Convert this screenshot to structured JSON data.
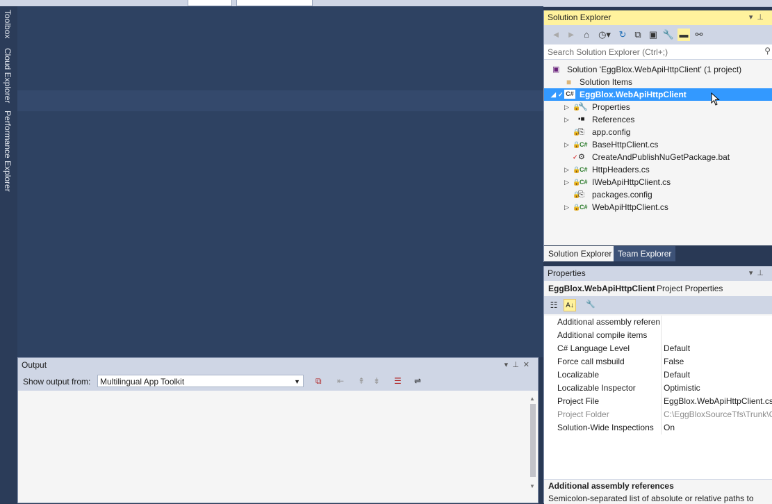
{
  "left_tabs": [
    "Toolbox",
    "Cloud Explorer",
    "Performance Explorer"
  ],
  "solution_explorer": {
    "title": "Solution Explorer",
    "search_placeholder": "Search Solution Explorer (Ctrl+;)",
    "toolbar_icons": [
      "back-icon",
      "forward-icon",
      "home-icon",
      "history-icon",
      "sync-icon",
      "collapse-all-icon",
      "show-all-files-icon",
      "properties-icon",
      "preview-icon",
      "class-diagram-icon"
    ],
    "tree": [
      {
        "label": "Solution 'EggBlox.WebApiHttpClient' (1 project)",
        "icon": "solution-icon"
      },
      {
        "label": "Solution Items",
        "icon": "folder-icon"
      },
      {
        "label": "EggBlox.WebApiHttpClient",
        "icon": "csharp-project-icon"
      },
      {
        "label": "Properties",
        "icon": "wrench-icon"
      },
      {
        "label": "References",
        "icon": "references-icon"
      },
      {
        "label": "app.config",
        "icon": "config-file-icon"
      },
      {
        "label": "BaseHttpClient.cs",
        "icon": "csharp-file-icon"
      },
      {
        "label": "CreateAndPublishNuGetPackage.bat",
        "icon": "bat-file-icon"
      },
      {
        "label": "HttpHeaders.cs",
        "icon": "csharp-file-icon"
      },
      {
        "label": "IWebApiHttpClient.cs",
        "icon": "csharp-file-icon"
      },
      {
        "label": "packages.config",
        "icon": "config-file-icon"
      },
      {
        "label": "WebApiHttpClient.cs",
        "icon": "csharp-file-icon"
      }
    ],
    "tabs": [
      "Solution Explorer",
      "Team Explorer"
    ]
  },
  "properties": {
    "title": "Properties",
    "object_name": "EggBlox.WebApiHttpClient",
    "object_type": "Project Properties",
    "rows": [
      {
        "name": "Additional assembly referen",
        "value": ""
      },
      {
        "name": "Additional compile items",
        "value": ""
      },
      {
        "name": "C# Language Level",
        "value": "Default"
      },
      {
        "name": "Force call msbuild",
        "value": "False"
      },
      {
        "name": "Localizable",
        "value": "Default"
      },
      {
        "name": "Localizable Inspector",
        "value": "Optimistic"
      },
      {
        "name": "Project File",
        "value": "EggBlox.WebApiHttpClient.cs"
      },
      {
        "name": "Project Folder",
        "value": "C:\\EggBloxSourceTfs\\Trunk\\C"
      },
      {
        "name": "Solution-Wide Inspections",
        "value": "On"
      }
    ],
    "description_title": "Additional assembly references",
    "description_text": "Semicolon-separated list of absolute or relative paths to"
  },
  "output": {
    "title": "Output",
    "show_from_label": "Show output from:",
    "source": "Multilingual App Toolkit"
  }
}
